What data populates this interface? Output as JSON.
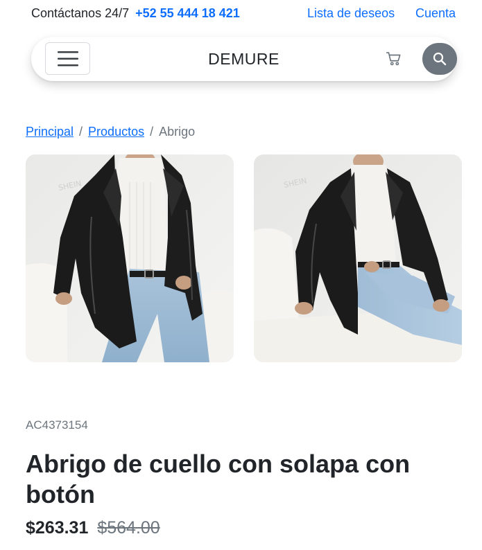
{
  "topbar": {
    "contact_label": "Contáctanos 24/7",
    "phone": "+52 55 444 18 421",
    "wishlist_label": "Lista de deseos",
    "account_label": "Cuenta"
  },
  "navbar": {
    "brand": "DEMURE",
    "menu_icon": "hamburger-icon",
    "cart_icon": "cart-icon",
    "search_icon": "search-icon"
  },
  "breadcrumb": {
    "items": [
      "Principal",
      "Productos",
      "Abrigo"
    ],
    "separator": "/"
  },
  "gallery": {
    "watermark": "SHEIN",
    "images": [
      {
        "alt": "front-view"
      },
      {
        "alt": "seated-view"
      }
    ]
  },
  "product": {
    "sku": "AC4373154",
    "title": "Abrigo de cuello con solapa con botón",
    "price": "$263.31",
    "original_price": "$564.00"
  },
  "colors": {
    "link": "#0d6efd",
    "text": "#212529",
    "muted": "#6c757d",
    "search_button": "#6c757d"
  }
}
